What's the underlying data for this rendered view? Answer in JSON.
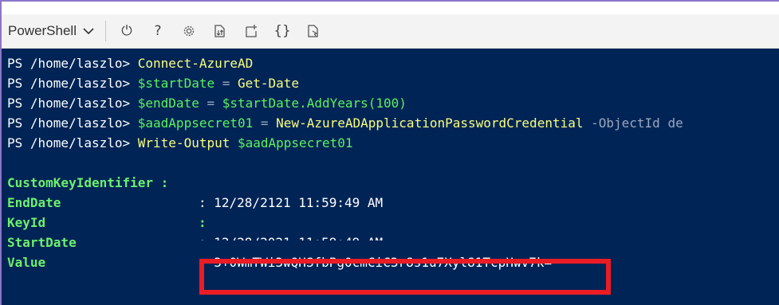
{
  "toolbar": {
    "shell_label": "PowerShell",
    "icons": [
      "power-icon",
      "help-icon",
      "settings-icon",
      "upload-download-icon",
      "new-session-icon",
      "braces-icon",
      "web-preview-icon"
    ],
    "icon_glyphs": {
      "power": "⏻",
      "help": "?",
      "braces": "{}"
    }
  },
  "terminal": {
    "prompt": "PS /home/laszlo>",
    "commands": [
      {
        "text": "Connect-AzureAD"
      },
      {
        "var": "$startDate",
        "op": " = ",
        "call": "Get-Date"
      },
      {
        "var": "$endDate",
        "op": " = ",
        "rest": "$startDate.AddYears(100)"
      },
      {
        "var": "$aadAppsecret01",
        "op": " = ",
        "call": "New-AzureADApplicationPasswordCredential",
        "param": " -ObjectId de"
      },
      {
        "text": "Write-Output",
        "arg": " $aadAppsecret01"
      }
    ],
    "output": [
      {
        "key": "CustomKeyIdentifier",
        "sep": " :",
        "value": ""
      },
      {
        "key": "EndDate",
        "sep": ": ",
        "value": "12/28/2121 11:59:49 AM"
      },
      {
        "key": "KeyId",
        "sep": ":",
        "value": ""
      },
      {
        "key": "StartDate",
        "sep": ": ",
        "value": "12/28/2021 11:59:49 AM"
      },
      {
        "key": "Value",
        "sep": ": ",
        "value": "3+0WmTWi3wQHSfbPg0cmCiC3r8s1u7Xyl81TcpHwv7k="
      }
    ]
  },
  "colors": {
    "terminal_bg": "#012456",
    "command_yellow": "#fafe7d",
    "variable_green": "#5cf25c",
    "highlight_red": "#ea1c24"
  }
}
